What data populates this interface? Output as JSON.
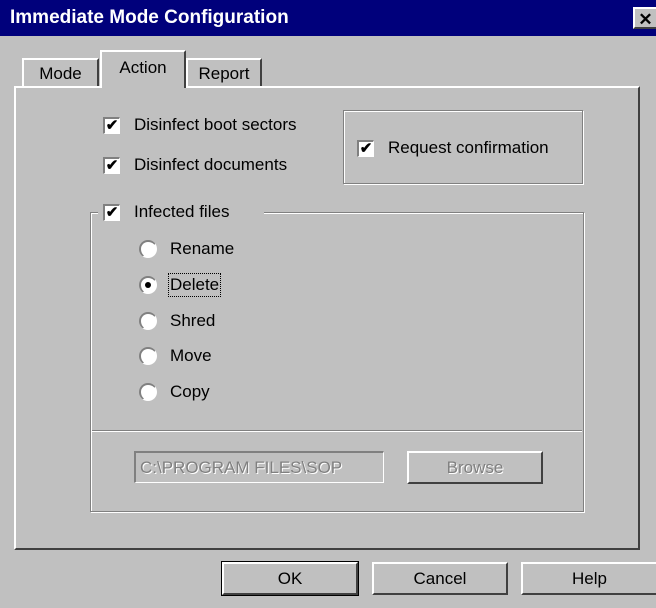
{
  "window": {
    "title": "Immediate Mode Configuration",
    "close_label": "✕"
  },
  "tabs": [
    {
      "label": "Mode",
      "active": false
    },
    {
      "label": "Action",
      "active": true
    },
    {
      "label": "Report",
      "active": false
    }
  ],
  "options": {
    "disinfect_boot": {
      "label": "Disinfect boot sectors",
      "checked": true
    },
    "disinfect_docs": {
      "label": "Disinfect documents",
      "checked": true
    },
    "request_confirmation": {
      "label": "Request confirmation",
      "checked": true
    },
    "infected_files": {
      "label": "Infected files",
      "checked": true
    }
  },
  "radios": [
    {
      "label": "Rename",
      "selected": false
    },
    {
      "label": "Delete",
      "selected": true
    },
    {
      "label": "Shred",
      "selected": false
    },
    {
      "label": "Move",
      "selected": false
    },
    {
      "label": "Copy",
      "selected": false
    }
  ],
  "path_field": {
    "value": "C:\\PROGRAM FILES\\SOP"
  },
  "browse_label": "Browse",
  "buttons": {
    "ok": "OK",
    "cancel": "Cancel",
    "help": "Help"
  },
  "check_mark": "✔",
  "colors": {
    "titlebar": "#00007b",
    "face": "#c0c0c0"
  }
}
